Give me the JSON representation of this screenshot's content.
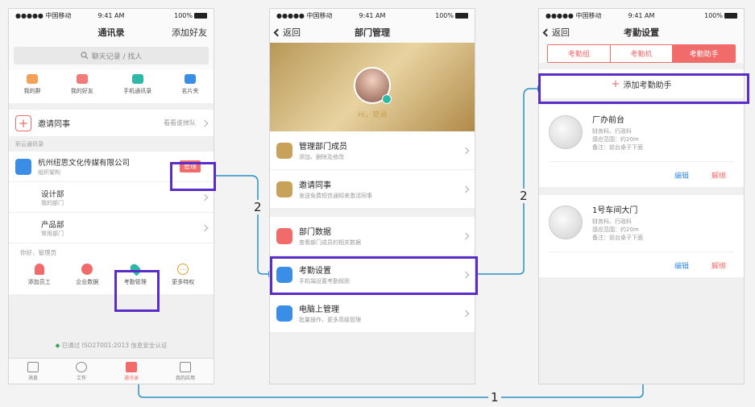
{
  "status": {
    "carrier": "●●●●● 中国移动",
    "time": "9:41 AM",
    "battery": "100%"
  },
  "phone1": {
    "title": "通讯录",
    "right_action": "添加好友",
    "search_placeholder": "聊天记录 / 找人",
    "quick": [
      {
        "label": "我的群",
        "color": "#f4a25b"
      },
      {
        "label": "我的好友",
        "color": "#f47a7a"
      },
      {
        "label": "手机通讯录",
        "color": "#2fb8a6"
      },
      {
        "label": "名片夹",
        "color": "#3a8ee6"
      }
    ],
    "invite": {
      "label": "邀请同事",
      "hint": "看看谁掉队"
    },
    "section": "彩云通讯录",
    "company": {
      "name": "杭州纽思文化传媒有限公司",
      "sub": "组织架构",
      "badge": "管理"
    },
    "depts": [
      {
        "name": "设计部",
        "sub": "我的部门"
      },
      {
        "name": "产品部",
        "sub": "常用部门"
      }
    ],
    "greeting": "你好，管理员",
    "tools": [
      {
        "label": "添加员工",
        "color": "#f26b6b"
      },
      {
        "label": "企业数据",
        "color": "#f26b6b"
      },
      {
        "label": "考勤管理",
        "color": "#2fb8a6"
      },
      {
        "label": "更多特权",
        "color": "#e0a030"
      }
    ],
    "cert": "已通过 ISO27001:2013 信息安全认证",
    "tabs": [
      "消息",
      "工作",
      "通讯录",
      "我的应用"
    ]
  },
  "phone2": {
    "back": "返回",
    "title": "部门管理",
    "greeting": "Hi，楚涵",
    "items": [
      {
        "title": "管理部门成员",
        "sub": "添加、删除及修改",
        "color": "#c8a25a"
      },
      {
        "title": "邀请同事",
        "sub": "发送免费短信通知来激活同事",
        "color": "#c8a25a"
      },
      {
        "title": "部门数据",
        "sub": "查看部门成员的相关数据",
        "color": "#f26b6b"
      },
      {
        "title": "考勤设置",
        "sub": "手机端设置考勤规则",
        "color": "#3a8ee6"
      },
      {
        "title": "电脑上管理",
        "sub": "批量操作，更多高级管理",
        "color": "#3a8ee6"
      }
    ]
  },
  "phone3": {
    "back": "返回",
    "title": "考勤设置",
    "segments": [
      "考勤组",
      "考勤机",
      "考勤助手"
    ],
    "add": "添加考勤助手",
    "devices": [
      {
        "name": "厂办前台",
        "l1": "财务科、行政科",
        "l2": "感应范围：约20m",
        "l3": "备注：前台桌子下面"
      },
      {
        "name": "1号车间大门",
        "l1": "财务科、行政科",
        "l2": "感应范围：约20m",
        "l3": "备注：前台桌子下面"
      }
    ],
    "edit": "编辑",
    "unbind": "解绑"
  },
  "flow_labels": {
    "step1": "1",
    "step2a": "2",
    "step2b": "2"
  },
  "colors": {
    "accent": "#f26b6b",
    "highlight": "#5a2dc8",
    "connector": "#2a8fc6",
    "link": "#3a8ee6"
  }
}
